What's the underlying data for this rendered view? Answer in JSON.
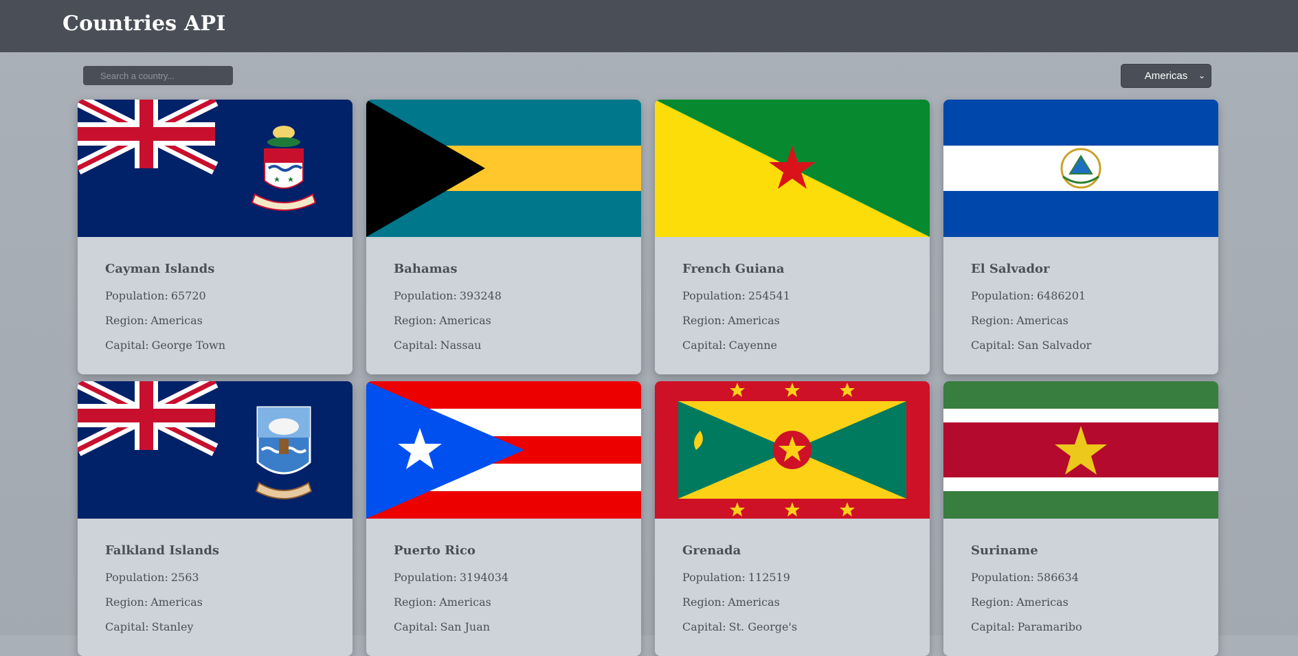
{
  "header": {
    "title": "Countries API"
  },
  "search": {
    "placeholder": "Search a country..."
  },
  "filter": {
    "selected": "Americas"
  },
  "labels": {
    "population": "Population:",
    "region": "Region:",
    "capital": "Capital:"
  },
  "countries": [
    {
      "name": "Cayman Islands",
      "population": "65720",
      "region": "Americas",
      "capital": "George Town",
      "flag": "cayman-islands-flag"
    },
    {
      "name": "Bahamas",
      "population": "393248",
      "region": "Americas",
      "capital": "Nassau",
      "flag": "bahamas-flag"
    },
    {
      "name": "French Guiana",
      "population": "254541",
      "region": "Americas",
      "capital": "Cayenne",
      "flag": "french-guiana-flag"
    },
    {
      "name": "El Salvador",
      "population": "6486201",
      "region": "Americas",
      "capital": "San Salvador",
      "flag": "el-salvador-flag"
    },
    {
      "name": "Falkland Islands",
      "population": "2563",
      "region": "Americas",
      "capital": "Stanley",
      "flag": "falkland-islands-flag"
    },
    {
      "name": "Puerto Rico",
      "population": "3194034",
      "region": "Americas",
      "capital": "San Juan",
      "flag": "puerto-rico-flag"
    },
    {
      "name": "Grenada",
      "population": "112519",
      "region": "Americas",
      "capital": "St. George's",
      "flag": "grenada-flag"
    },
    {
      "name": "Suriname",
      "population": "586634",
      "region": "Americas",
      "capital": "Paramaribo",
      "flag": "suriname-flag"
    }
  ]
}
